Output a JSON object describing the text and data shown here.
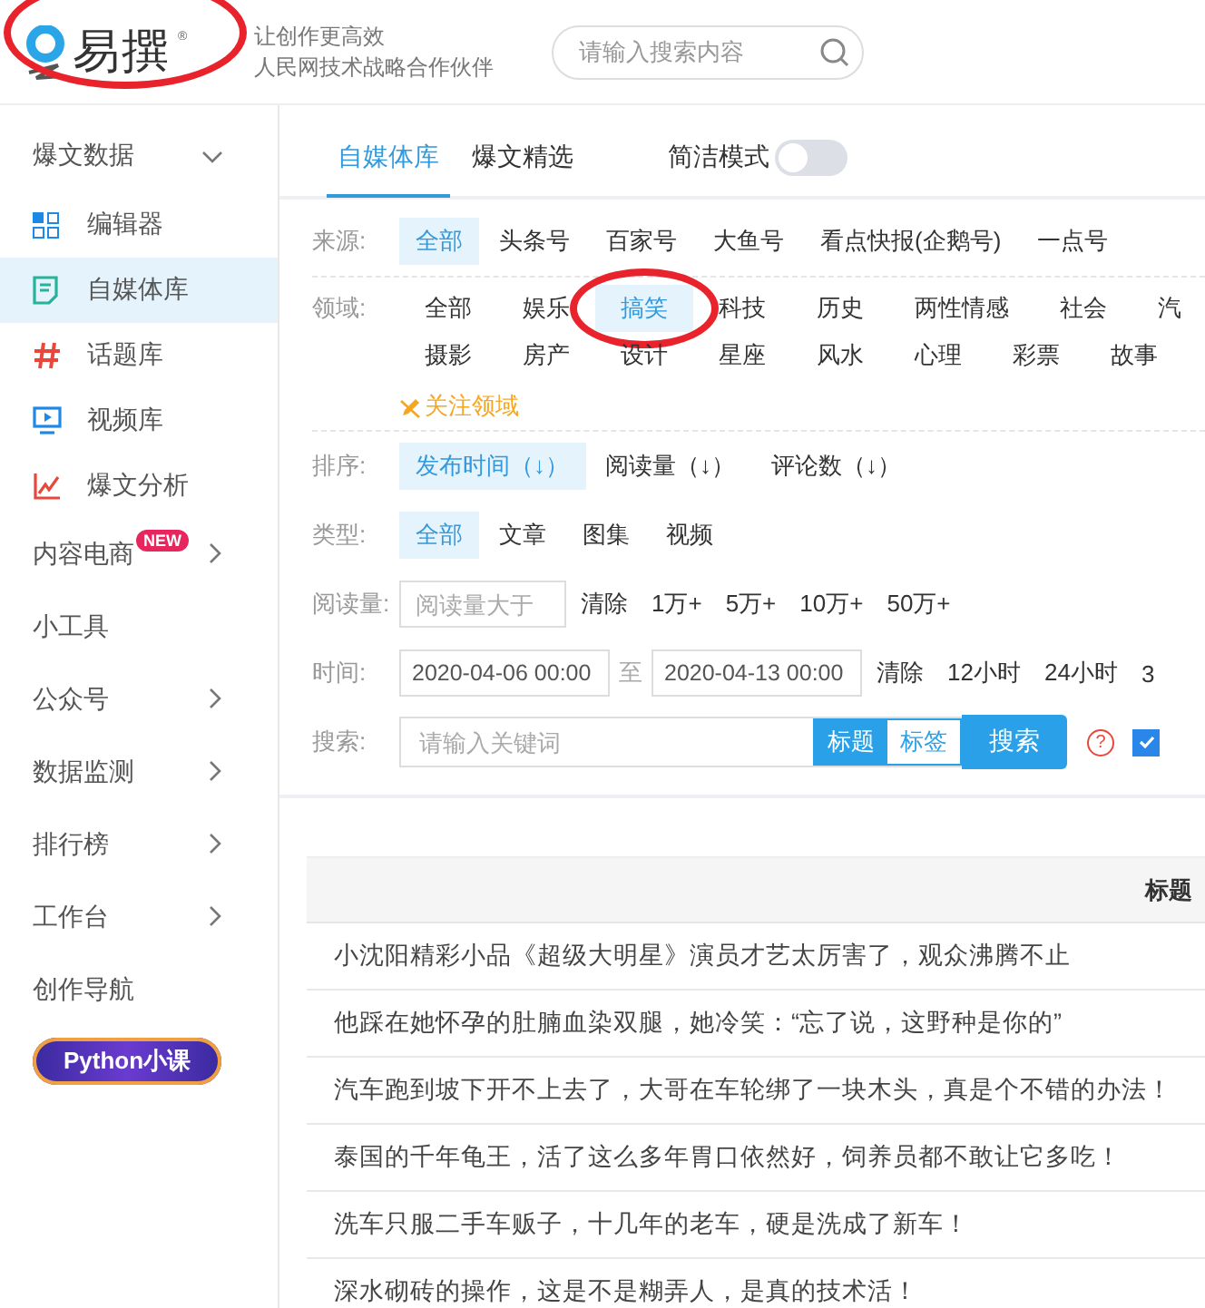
{
  "header": {
    "logo": {
      "text": "易撰",
      "mark": "®",
      "circled": true
    },
    "slogan": [
      "让创作更高效",
      "人民网技术战略合作伙伴"
    ],
    "search": {
      "placeholder": "请输入搜索内容"
    }
  },
  "sidebar": {
    "items": [
      {
        "kind": "group",
        "label": "爆文数据",
        "expanded": true
      },
      {
        "kind": "sub",
        "label": "编辑器",
        "selected": false
      },
      {
        "kind": "sub",
        "label": "自媒体库",
        "selected": true
      },
      {
        "kind": "sub",
        "label": "话题库",
        "selected": false
      },
      {
        "kind": "sub",
        "label": "视频库",
        "selected": false
      },
      {
        "kind": "sub",
        "label": "爆文分析",
        "selected": false
      },
      {
        "kind": "menu",
        "label": "内容电商",
        "badge": "NEW",
        "expanded": false
      },
      {
        "kind": "menu",
        "label": "小工具"
      },
      {
        "kind": "menu",
        "label": "公众号",
        "expanded": false
      },
      {
        "kind": "menu",
        "label": "数据监测",
        "expanded": false
      },
      {
        "kind": "menu",
        "label": "排行榜",
        "expanded": false
      },
      {
        "kind": "menu",
        "label": "工作台",
        "expanded": false
      },
      {
        "kind": "menu",
        "label": "创作导航"
      },
      {
        "kind": "promo",
        "label": "Python小课"
      }
    ]
  },
  "main": {
    "tabs": [
      {
        "label": "自媒体库",
        "selected": true
      },
      {
        "label": "爆文精选",
        "selected": false
      }
    ],
    "simple_mode": {
      "label": "简洁模式",
      "on": false
    },
    "filters": [
      {
        "kind": "options",
        "label": "来源:",
        "options": [
          {
            "label": "全部",
            "selected": true
          },
          {
            "label": "头条号",
            "selected": false
          },
          {
            "label": "百家号",
            "selected": false
          },
          {
            "label": "大鱼号",
            "selected": false
          },
          {
            "label": "看点快报(企鹅号)",
            "selected": false
          },
          {
            "label": "一点号",
            "selected": false
          }
        ]
      },
      {
        "kind": "grid",
        "label": "领域:",
        "rows": [
          [
            {
              "label": "全部",
              "selected": false
            },
            {
              "label": "娱乐",
              "selected": false
            },
            {
              "label": "搞笑",
              "selected": true,
              "circled": true
            },
            {
              "label": "科技",
              "selected": false
            },
            {
              "label": "历史",
              "selected": false
            },
            {
              "label": "两性情感",
              "selected": false
            },
            {
              "label": "社会",
              "selected": false
            },
            {
              "label": "汽",
              "selected": false
            }
          ],
          [
            {
              "label": "摄影",
              "selected": false
            },
            {
              "label": "房产",
              "selected": false
            },
            {
              "label": "设计",
              "selected": false
            },
            {
              "label": "星座",
              "selected": false
            },
            {
              "label": "风水",
              "selected": false
            },
            {
              "label": "心理",
              "selected": false
            },
            {
              "label": "彩票",
              "selected": false
            },
            {
              "label": "故事",
              "selected": false
            }
          ]
        ],
        "link": "关注领域"
      },
      {
        "kind": "options",
        "label": "排序:",
        "options": [
          {
            "label": "发布时间（↓）",
            "selected": true
          },
          {
            "label": "阅读量（↓）",
            "selected": false
          },
          {
            "label": "评论数（↓）",
            "selected": false
          }
        ]
      },
      {
        "kind": "options",
        "label": "类型:",
        "options": [
          {
            "label": "全部",
            "selected": true
          },
          {
            "label": "文章",
            "selected": false
          },
          {
            "label": "图集",
            "selected": false
          },
          {
            "label": "视频",
            "selected": false
          }
        ]
      },
      {
        "kind": "range",
        "label": "阅读量:",
        "placeholder": "阅读量大于",
        "links": [
          "清除",
          "1万+",
          "5万+",
          "10万+",
          "50万+"
        ]
      },
      {
        "kind": "dates",
        "label": "时间:",
        "from": "2020-04-06 00:00",
        "separator": "至",
        "to": "2020-04-13 00:00",
        "links": [
          "清除",
          "12小时",
          "24小时",
          "3"
        ]
      },
      {
        "kind": "search",
        "label": "搜索:",
        "placeholder": "请输入关键词",
        "scopes": [
          {
            "label": "标题",
            "selected": true
          },
          {
            "label": "标签",
            "selected": false
          }
        ],
        "button": "搜索",
        "help": "?",
        "checked": true
      }
    ]
  },
  "table": {
    "columns": [
      "标题"
    ],
    "rows": [
      "小沈阳精彩小品《超级大明星》演员才艺太厉害了，观众沸腾不止",
      "他踩在她怀孕的肚腩血染双腿，她冷笑：“忘了说，这野种是你的”",
      "汽车跑到坡下开不上去了，大哥在车轮绑了一块木头，真是个不错的办法！",
      "泰国的千年龟王，活了这么多年胃口依然好，饲养员都不敢让它多吃！",
      "洗车只服二手车贩子，十几年的老车，硬是洗成了新车！",
      "深水砌砖的操作，这是不是糊弄人，是真的技术活！"
    ]
  }
}
